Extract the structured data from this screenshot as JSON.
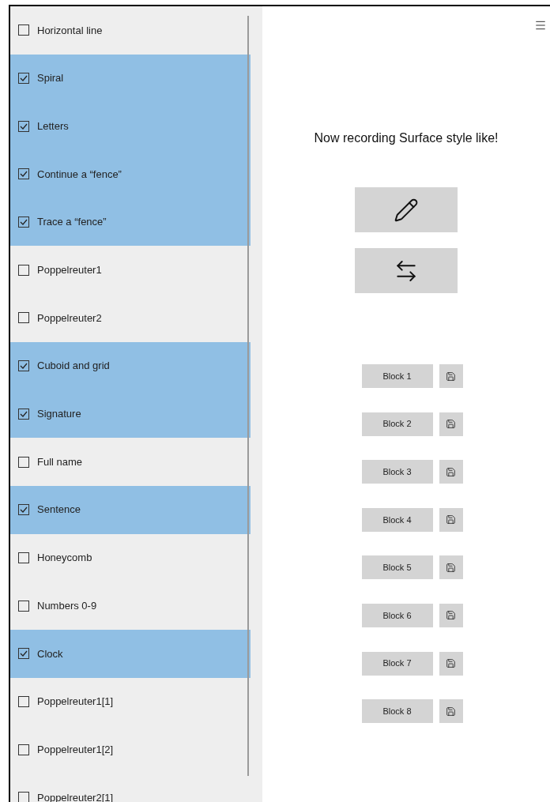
{
  "tasks": [
    {
      "label": "Horizontal line",
      "checked": false
    },
    {
      "label": "Spiral",
      "checked": true
    },
    {
      "label": "Letters",
      "checked": true
    },
    {
      "label": "Continue a “fence”",
      "checked": true
    },
    {
      "label": "Trace a “fence”",
      "checked": true
    },
    {
      "label": "Poppelreuter1",
      "checked": false
    },
    {
      "label": "Poppelreuter2",
      "checked": false
    },
    {
      "label": "Cuboid and grid",
      "checked": true
    },
    {
      "label": "Signature",
      "checked": true
    },
    {
      "label": "Full name",
      "checked": false
    },
    {
      "label": "Sentence",
      "checked": true
    },
    {
      "label": "Honeycomb",
      "checked": false
    },
    {
      "label": "Numbers 0-9",
      "checked": false
    },
    {
      "label": "Clock",
      "checked": true
    },
    {
      "label": "Poppelreuter1[1]",
      "checked": false
    },
    {
      "label": "Poppelreuter1[2]",
      "checked": false
    },
    {
      "label": "Poppelreuter2[1]",
      "checked": false
    }
  ],
  "status": "Now recording Surface style like!",
  "blocks": [
    "Block 1",
    "Block 2",
    "Block 3",
    "Block 4",
    "Block 5",
    "Block 6",
    "Block 7",
    "Block 8"
  ]
}
